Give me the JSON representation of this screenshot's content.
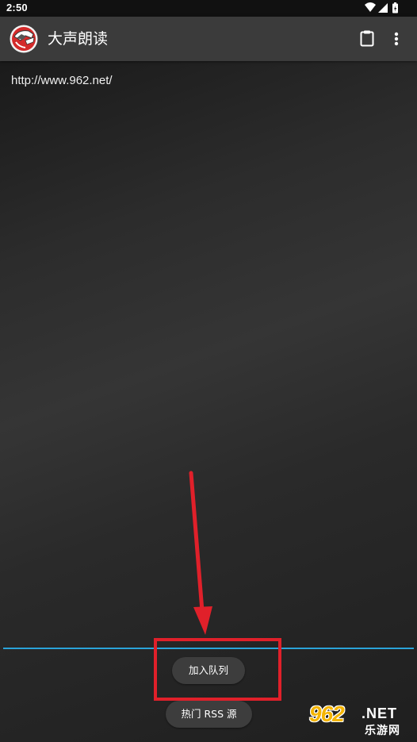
{
  "status_bar": {
    "time": "2:50",
    "icons": [
      "wifi-icon",
      "signal-icon",
      "battery-icon"
    ]
  },
  "app_bar": {
    "title": "大声朗读",
    "actions": [
      "clipboard-icon",
      "overflow-menu-icon"
    ]
  },
  "content": {
    "url_text": "http://www.962.net/"
  },
  "buttons": {
    "add_to_queue": "加入队列",
    "popular_rss": "热门 RSS 源"
  },
  "annotations": {
    "highlight_color": "#e0202a",
    "accent_color": "#2aa3d9"
  },
  "watermark": {
    "number": "962",
    "suffix": ".NET",
    "site": "乐游网"
  }
}
